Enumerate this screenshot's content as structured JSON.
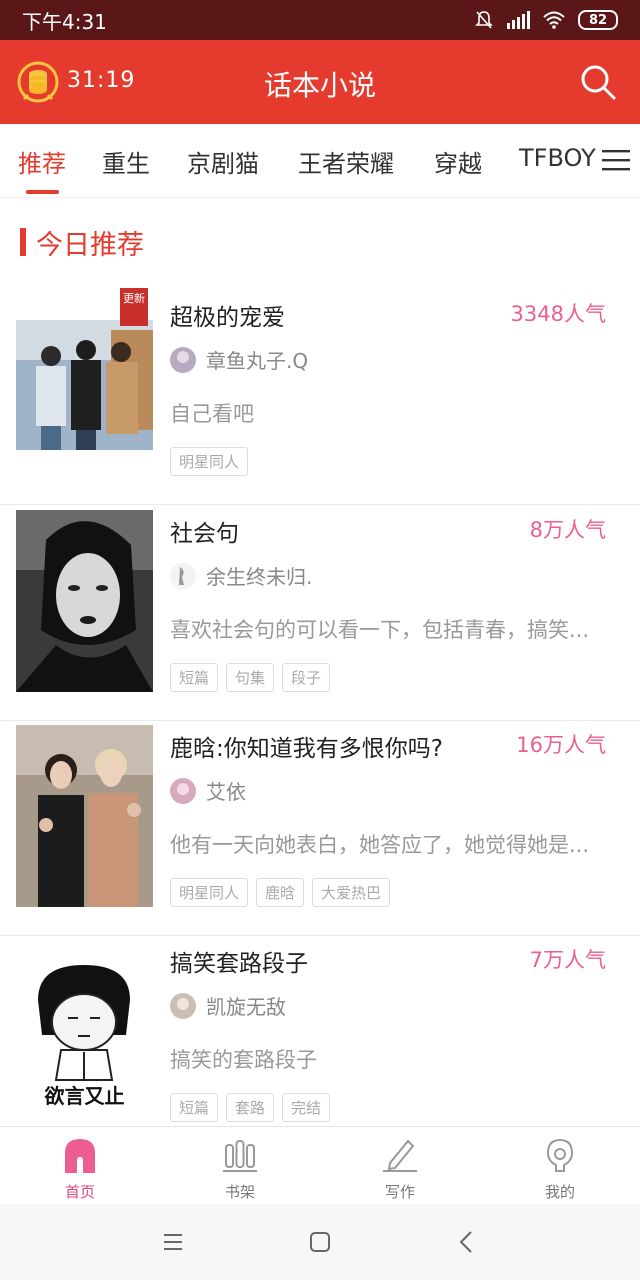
{
  "status_bar": {
    "time": "下午4:31",
    "battery": "82"
  },
  "header": {
    "timer": "31:19",
    "title": "话本小说"
  },
  "tabs": [
    {
      "label": "推荐",
      "active": true
    },
    {
      "label": "重生"
    },
    {
      "label": "京剧猫"
    },
    {
      "label": "王者荣耀"
    },
    {
      "label": "穿越"
    },
    {
      "label": "TFBOY"
    }
  ],
  "section": {
    "title": "今日推荐"
  },
  "books": [
    {
      "title": "超极的宠爱",
      "popularity": "3348人气",
      "author": "章鱼丸子.Q",
      "desc": "自己看吧",
      "tags": [
        "明星同人"
      ],
      "badge": "更新"
    },
    {
      "title": "社会句",
      "popularity": "8万人气",
      "author": "余生终未归.",
      "desc": "喜欢社会句的可以看一下，包括青春，搞笑...",
      "tags": [
        "短篇",
        "句集",
        "段子"
      ]
    },
    {
      "title": "鹿晗:你知道我有多恨你吗?",
      "popularity": "16万人气",
      "author": "艾依",
      "desc": "他有一天向她表白，她答应了，她觉得她是...",
      "tags": [
        "明星同人",
        "鹿晗",
        "大爱热巴"
      ]
    },
    {
      "title": "搞笑套路段子",
      "popularity": "7万人气",
      "author": "凯旋无敌",
      "desc": "搞笑的套路段子",
      "tags": [
        "短篇",
        "套路",
        "完结"
      ],
      "cover_caption": "欲言又止"
    }
  ],
  "bottom_nav": [
    {
      "label": "首页",
      "icon": "home-icon",
      "active": true
    },
    {
      "label": "书架",
      "icon": "bookshelf-icon"
    },
    {
      "label": "写作",
      "icon": "pencil-icon"
    },
    {
      "label": "我的",
      "icon": "profile-icon"
    }
  ],
  "colors": {
    "brand": "#e53b2f",
    "popularity": "#ec5e8f",
    "nav_active": "#e0457e"
  }
}
